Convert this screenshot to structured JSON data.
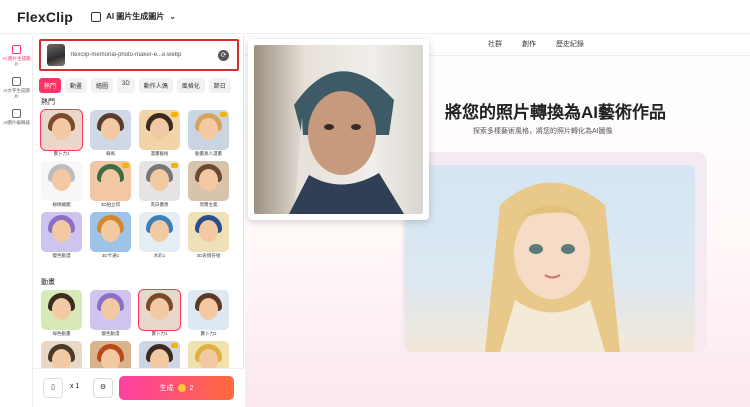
{
  "app": {
    "logo": "FlexClip",
    "tool_name": "AI 圖片生成圖片"
  },
  "rail": [
    {
      "label": "AI 圖片生成圖片",
      "icon": "image-gen-icon",
      "active": true
    },
    {
      "label": "AI文字生成圖片",
      "icon": "text-to-image-icon",
      "active": false
    },
    {
      "label": "AI圖片編輯器",
      "icon": "image-editor-icon",
      "active": false
    }
  ],
  "upload": {
    "filename": "flexclip-memorial-photo-maker-e...e.webp"
  },
  "categories": [
    "熱門",
    "動畫",
    "繪圖",
    "3D",
    "動作人偶",
    "風格化",
    "節日"
  ],
  "sections": [
    {
      "title": "熱門",
      "tiles": [
        {
          "label": "賣卜力1",
          "hair": "#7a4a2a",
          "bg": "#e9d7c9",
          "selected": true,
          "crown": false
        },
        {
          "label": "韓風",
          "hair": "#5b3c2c",
          "bg": "#cfd9e6",
          "selected": false,
          "crown": false
        },
        {
          "label": "漫畫藝術",
          "hair": "#3a2a20",
          "bg": "#f3d4a8",
          "selected": false,
          "crown": true
        },
        {
          "label": "動畫真人漫畫",
          "hair": "#d4a55a",
          "bg": "#c9d6e2",
          "selected": false,
          "crown": true
        },
        {
          "label": "線條繪圖",
          "hair": "#bdbdbd",
          "bg": "#f7f7f7",
          "selected": false,
          "crown": false
        },
        {
          "label": "3D拍立得",
          "hair": "#3d6e45",
          "bg": "#f1c7a5",
          "selected": false,
          "crown": true
        },
        {
          "label": "黑白畫像",
          "hair": "#777777",
          "bg": "#e4e4e4",
          "selected": false,
          "crown": true
        },
        {
          "label": "現實主義",
          "hair": "#6b4a30",
          "bg": "#d8c3ad",
          "selected": false,
          "crown": false
        },
        {
          "label": "變色動漫",
          "hair": "#8a6fc5",
          "bg": "#cfc4ef",
          "selected": false,
          "crown": false
        },
        {
          "label": "3D卡通1",
          "hair": "#d08a2a",
          "bg": "#9fc3e6",
          "selected": false,
          "crown": false
        },
        {
          "label": "水彩1",
          "hair": "#3f7fb8",
          "bg": "#e6eef5",
          "selected": false,
          "crown": false
        },
        {
          "label": "3D表情符號",
          "hair": "#2a4f8a",
          "bg": "#efe1b7",
          "selected": false,
          "crown": false
        }
      ]
    },
    {
      "title": "動畫",
      "tiles": [
        {
          "label": "綠色動畫",
          "hair": "#3c2b1f",
          "bg": "#d7e9b6",
          "selected": false,
          "crown": false
        },
        {
          "label": "變色動漫",
          "hair": "#8a6fc5",
          "bg": "#cfc4ef",
          "selected": false,
          "crown": false
        },
        {
          "label": "賣卜力1",
          "hair": "#7a4a2a",
          "bg": "#e9d7c9",
          "selected": true,
          "crown": false
        },
        {
          "label": "賣卜力2",
          "hair": "#5a3a24",
          "bg": "#dde8f2",
          "selected": false,
          "crown": false
        },
        {
          "label": "",
          "hair": "#4a3a2a",
          "bg": "#e8d8c6",
          "selected": false,
          "crown": false
        },
        {
          "label": "",
          "hair": "#b84a1a",
          "bg": "#d9b38c",
          "selected": false,
          "crown": false
        },
        {
          "label": "",
          "hair": "#3a2a20",
          "bg": "#cdd7e3",
          "selected": false,
          "crown": true
        },
        {
          "label": "",
          "hair": "#e0b040",
          "bg": "#f0e2b0",
          "selected": false,
          "crown": false
        }
      ]
    }
  ],
  "bottom": {
    "count": "x 1",
    "generate_label": "生成",
    "cost": "2"
  },
  "main": {
    "tabs": [
      {
        "label": "社群",
        "active": false
      },
      {
        "label": "創作",
        "active": true
      },
      {
        "label": "歷史紀錄",
        "active": false
      }
    ],
    "headline": "將您的照片轉換為AI藝術作品",
    "subline": "探索多樣藝術風格，將您的照片轉化為AI圖像"
  },
  "colors": {
    "accent": "#ff3366",
    "highlight_box": "#d32f2f"
  }
}
